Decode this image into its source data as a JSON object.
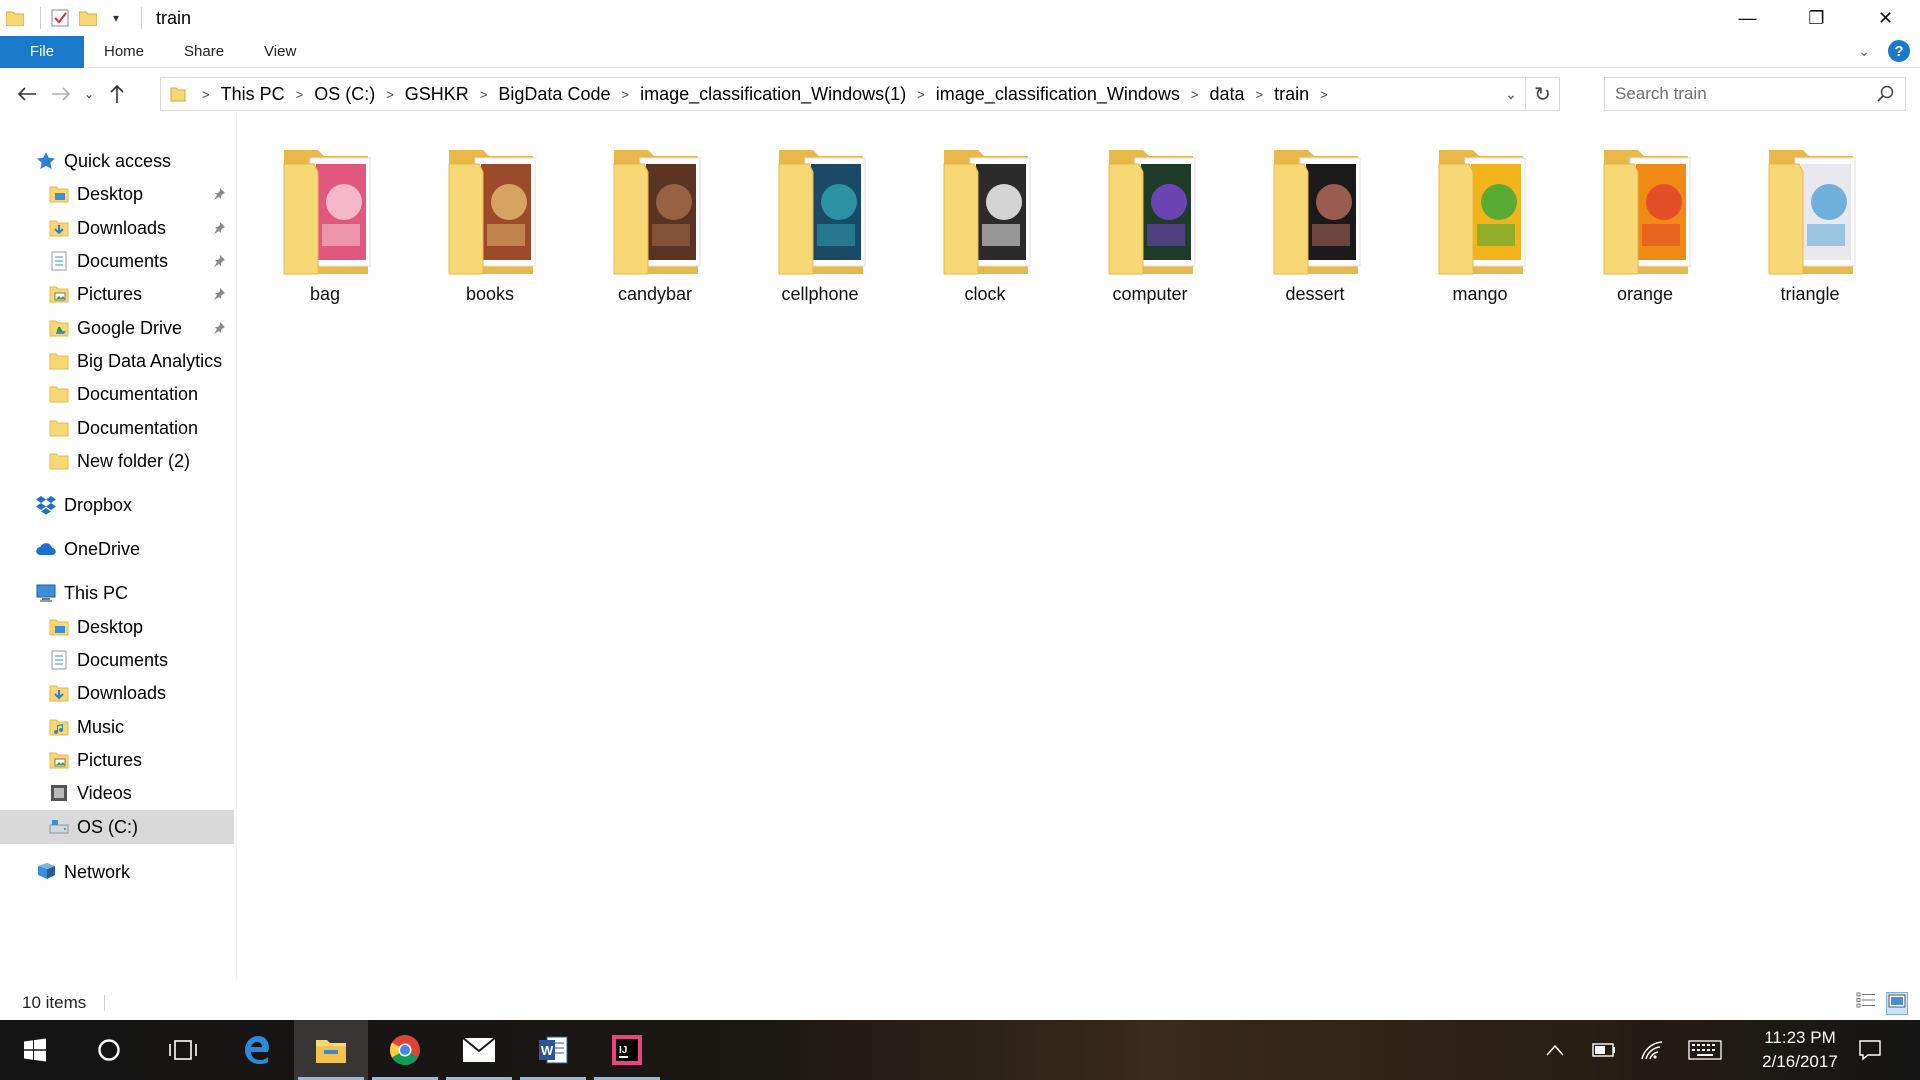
{
  "window": {
    "title": "train",
    "minimize_glyph": "—",
    "restore_glyph": "❐",
    "close_glyph": "✕"
  },
  "ribbon": {
    "file_label": "File",
    "tabs": [
      "Home",
      "Share",
      "View"
    ],
    "help_glyph": "?"
  },
  "address": {
    "breadcrumbs": [
      "This PC",
      "OS (C:)",
      "GSHKR",
      "BigData Code",
      "image_classification_Windows(1)",
      "image_classification_Windows",
      "data",
      "train"
    ],
    "search_placeholder": "Search train"
  },
  "sidebar": {
    "items": [
      {
        "label": "Quick access",
        "icon": "star-icon",
        "pinned": false,
        "indent": 1
      },
      {
        "label": "Desktop",
        "icon": "desktop-folder-icon",
        "pinned": true,
        "indent": 2
      },
      {
        "label": "Downloads",
        "icon": "downloads-folder-icon",
        "pinned": true,
        "indent": 2
      },
      {
        "label": "Documents",
        "icon": "documents-folder-icon",
        "pinned": true,
        "indent": 2
      },
      {
        "label": "Pictures",
        "icon": "pictures-folder-icon",
        "pinned": true,
        "indent": 2
      },
      {
        "label": "Google Drive",
        "icon": "google-drive-folder-icon",
        "pinned": true,
        "indent": 2
      },
      {
        "label": "Big Data Analytics",
        "icon": "folder-icon",
        "pinned": false,
        "indent": 2
      },
      {
        "label": "Documentation",
        "icon": "folder-icon",
        "pinned": false,
        "indent": 2
      },
      {
        "label": "Documentation",
        "icon": "folder-icon",
        "pinned": false,
        "indent": 2
      },
      {
        "label": "New folder (2)",
        "icon": "folder-icon",
        "pinned": false,
        "indent": 2
      },
      {
        "label": "Dropbox",
        "icon": "dropbox-icon",
        "pinned": false,
        "indent": 1
      },
      {
        "label": "OneDrive",
        "icon": "onedrive-icon",
        "pinned": false,
        "indent": 1
      },
      {
        "label": "This PC",
        "icon": "this-pc-icon",
        "pinned": false,
        "indent": 1
      },
      {
        "label": "Desktop",
        "icon": "desktop-folder-icon",
        "pinned": false,
        "indent": 2
      },
      {
        "label": "Documents",
        "icon": "documents-folder-icon",
        "pinned": false,
        "indent": 2
      },
      {
        "label": "Downloads",
        "icon": "downloads-folder-icon",
        "pinned": false,
        "indent": 2
      },
      {
        "label": "Music",
        "icon": "music-folder-icon",
        "pinned": false,
        "indent": 2
      },
      {
        "label": "Pictures",
        "icon": "pictures-folder-icon",
        "pinned": false,
        "indent": 2
      },
      {
        "label": "Videos",
        "icon": "videos-folder-icon",
        "pinned": false,
        "indent": 2
      },
      {
        "label": "OS (C:)",
        "icon": "drive-icon",
        "pinned": false,
        "indent": 2,
        "selected": true
      },
      {
        "label": "Network",
        "icon": "network-icon",
        "pinned": false,
        "indent": 1
      }
    ]
  },
  "folders": [
    {
      "name": "bag",
      "thumb_color": "#e2577e",
      "thumb_accent": "#f7c9d6"
    },
    {
      "name": "books",
      "thumb_color": "#9c4a2a",
      "thumb_accent": "#e0b36a"
    },
    {
      "name": "candybar",
      "thumb_color": "#5b3322",
      "thumb_accent": "#a36a4a"
    },
    {
      "name": "cellphone",
      "thumb_color": "#1a4a66",
      "thumb_accent": "#2f9fae"
    },
    {
      "name": "clock",
      "thumb_color": "#2b2b2b",
      "thumb_accent": "#f2f2f2"
    },
    {
      "name": "computer",
      "thumb_color": "#1f3b2a",
      "thumb_accent": "#7a46c9"
    },
    {
      "name": "dessert",
      "thumb_color": "#1a1a1a",
      "thumb_accent": "#b06a5a"
    },
    {
      "name": "mango",
      "thumb_color": "#f1b41a",
      "thumb_accent": "#3fa93a"
    },
    {
      "name": "orange",
      "thumb_color": "#f08a14",
      "thumb_accent": "#e0452a"
    },
    {
      "name": "triangle",
      "thumb_color": "#e8e8ee",
      "thumb_accent": "#5aa7d8"
    }
  ],
  "status": {
    "item_count": "10 items"
  },
  "taskbar": {
    "apps": [
      "start-icon",
      "cortana-icon",
      "task-view-icon",
      "edge-icon",
      "file-explorer-icon",
      "chrome-icon",
      "mail-icon",
      "word-icon",
      "intellij-icon"
    ],
    "time": "11:23 PM",
    "date": "2/16/2017"
  },
  "colors": {
    "accent": "#1979ca",
    "folder_yellow": "#f8d775",
    "folder_yellow_dark": "#e8b94a",
    "selected_bg": "#d9d9d9"
  }
}
